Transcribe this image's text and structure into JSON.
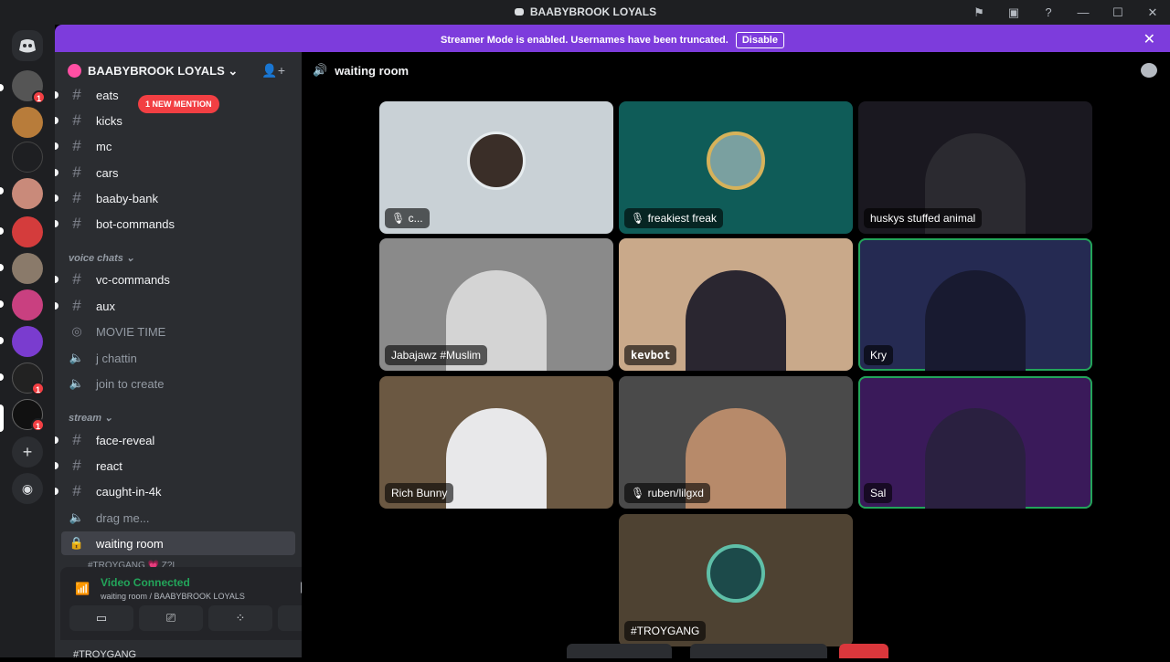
{
  "window": {
    "title": "BAABYBROOK LOYALS"
  },
  "banner": {
    "text": "Streamer Mode is enabled. Usernames have been truncated.",
    "disable_label": "Disable"
  },
  "server": {
    "name": "BAABYBROOK LOYALS ⌄",
    "mention_pill": "1 NEW MENTION"
  },
  "guild_badges": [
    "1",
    "1",
    "1"
  ],
  "channels": {
    "text_top": [
      "eats",
      "kicks",
      "mc",
      "cars",
      "baaby-bank",
      "bot-commands"
    ],
    "voice_category": "voice chats ⌄",
    "voice_text": [
      "vc-commands",
      "aux"
    ],
    "voice_channels": [
      "MOVIE TIME",
      "j chattin",
      "join to create"
    ],
    "stream_category": "stream ⌄",
    "stream_text": [
      "face-reveal",
      "react",
      "caught-in-4k"
    ],
    "stream_voice": [
      "drag me..."
    ],
    "selected": "waiting room",
    "sub_user": "#TROYGANG 💗 Z?L"
  },
  "voice_panel": {
    "status": "Video Connected",
    "location": "waiting room / BAABYBROOK LOYALS"
  },
  "user_area": {
    "name": "#TROYGANG"
  },
  "main": {
    "channel_name": "waiting room"
  },
  "tiles": [
    {
      "label": "c...",
      "muted": true
    },
    {
      "label": "freakiest freak",
      "muted": true
    },
    {
      "label": "huskys stuffed animal",
      "muted": false
    },
    {
      "label": "Jabajawz #Muslim",
      "muted": false
    },
    {
      "label": "kevbot",
      "muted": false
    },
    {
      "label": "Kry",
      "muted": false
    },
    {
      "label": "Rich Bunny",
      "muted": false
    },
    {
      "label": "ruben/lilgxd",
      "muted": true
    },
    {
      "label": "Sal",
      "muted": false
    },
    {
      "label": "#TROYGANG",
      "muted": false
    }
  ],
  "icons": {
    "mic_muted": "🎙",
    "hash": "#",
    "speaker": "🔊",
    "lock": "🔒"
  },
  "colors": {
    "streamer_banner": "#7d3cdc",
    "speaking": "#23a55a",
    "mention": "#f23f43"
  }
}
